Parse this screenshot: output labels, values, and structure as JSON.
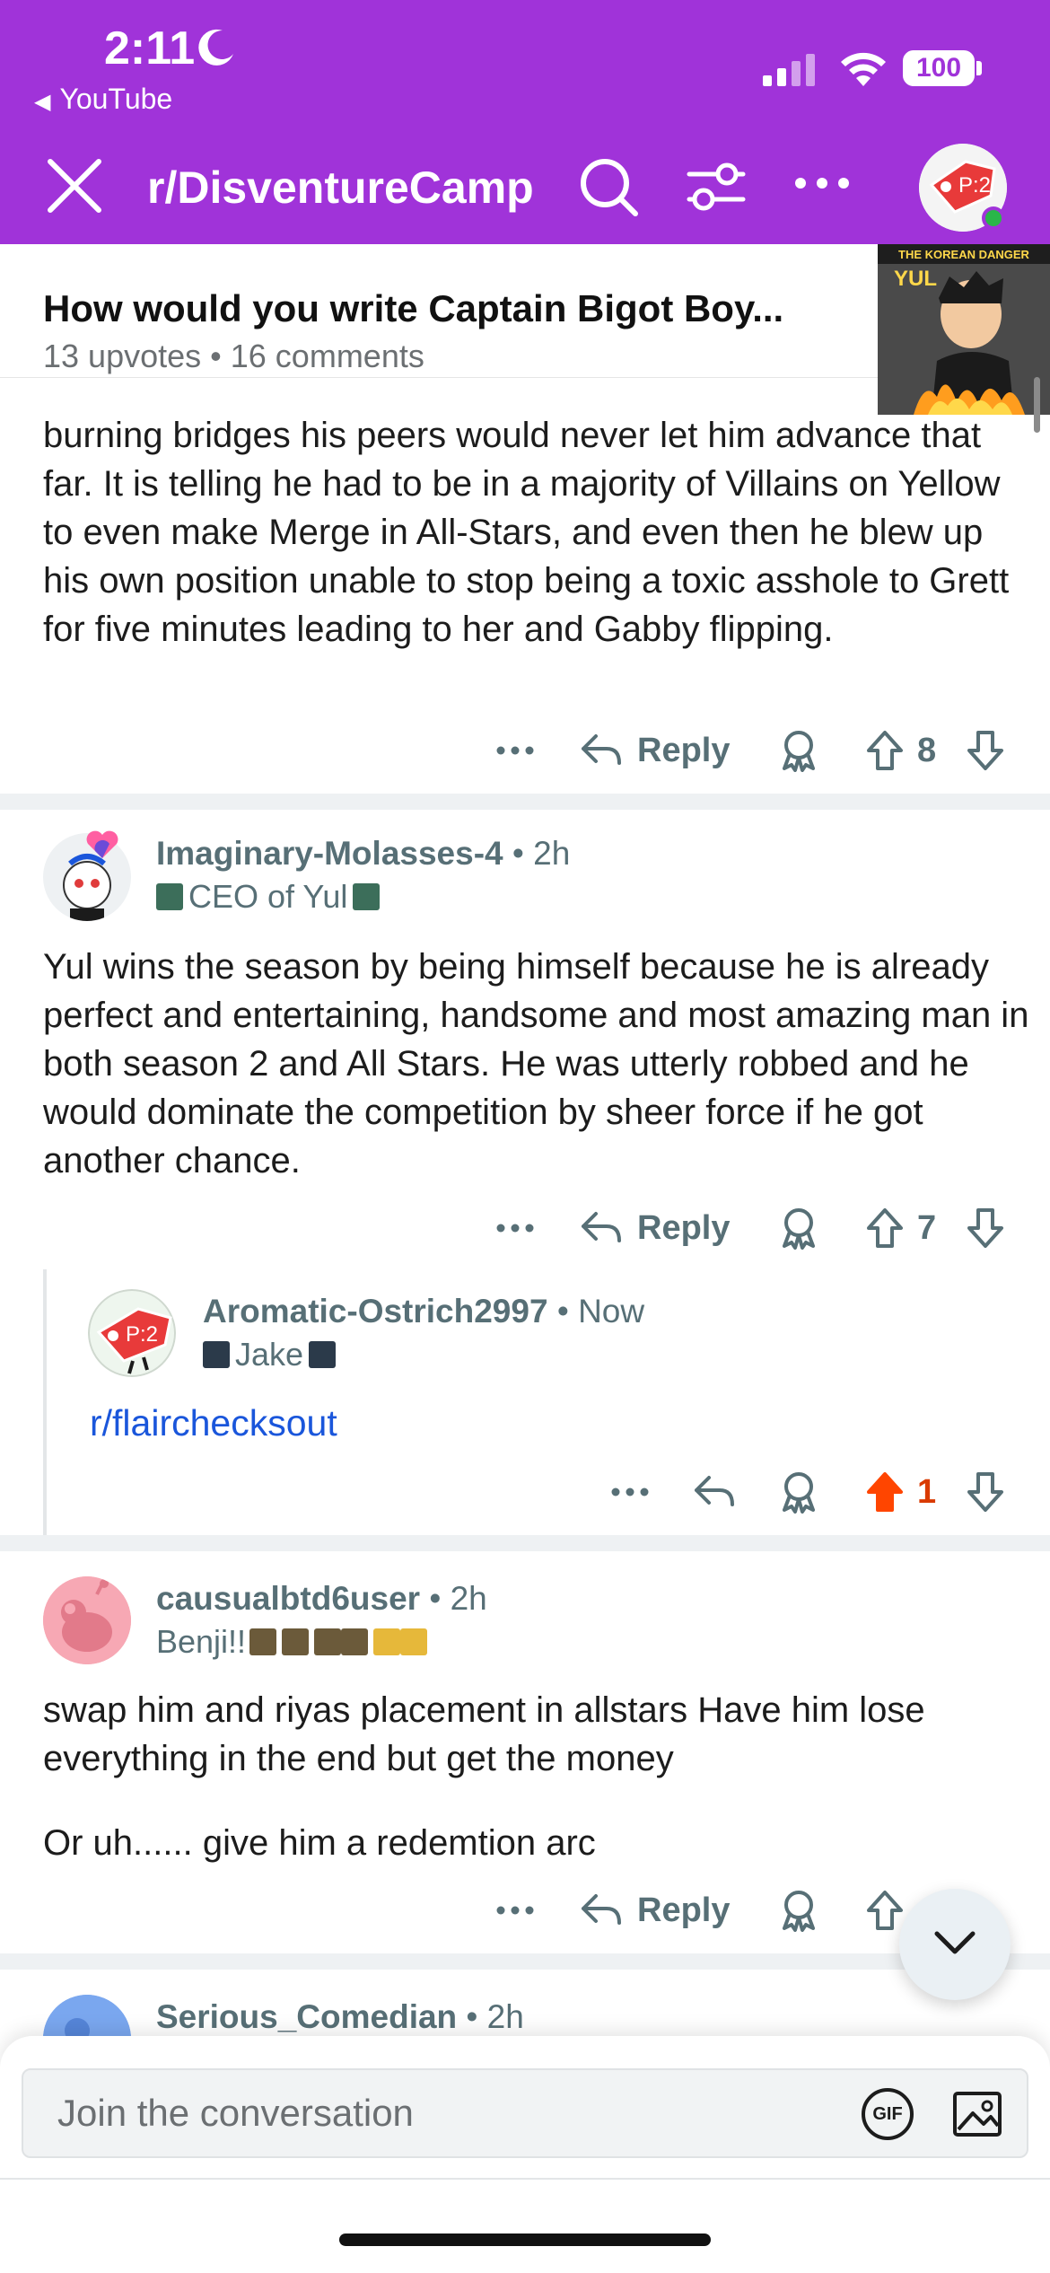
{
  "status_bar": {
    "time": "2:11",
    "back_app": "YouTube",
    "battery": "100"
  },
  "header": {
    "subreddit": "r/DisventureCamp",
    "avatar_badge": "P:2"
  },
  "post": {
    "title": "How would you write Captain Bigot Boy...",
    "upvotes": "13 upvotes",
    "comments": "16 comments",
    "thumbnail_caption": "THE KOREAN DANGER",
    "thumbnail_name": "YUL"
  },
  "comments": [
    {
      "body_tail": "burning bridges his peers would never let him advance that far. It is telling he had to be in a majority of Villains on Yellow to even make Merge in All-Stars, and even then he blew up his own position unable to stop being a toxic asshole to Grett for five minutes leading to her and Gabby flipping.",
      "reply_label": "Reply",
      "votes": "8"
    },
    {
      "user": "Imaginary-Molasses-4",
      "time": "2h",
      "flair": "CEO of Yul",
      "body": "Yul wins the season by being himself because he is already perfect and entertaining, handsome and most amazing man in both season 2 and All Stars. He was utterly robbed and he would dominate the competition by sheer force if he got another chance.",
      "reply_label": "Reply",
      "votes": "7"
    },
    {
      "user": "Aromatic-Ostrich2997",
      "time": "Now",
      "flair": "Jake",
      "body": "r/flairchecksout",
      "avatar_badge": "P:2",
      "votes": "1"
    },
    {
      "user": "causualbtd6user",
      "time": "2h",
      "flair": "Benji!!",
      "body_1": "swap him and riyas placement in allstars Have him lose everything in the end but get the money",
      "body_2": "Or uh...... give him a redemtion arc",
      "reply_label": "Reply"
    },
    {
      "user": "Serious_Comedian",
      "time": "2h"
    }
  ],
  "composer": {
    "placeholder": "Join the conversation",
    "gif_label": "GIF"
  },
  "colors": {
    "brand_purple": "#a033d9",
    "upvote_active": "#ff4500",
    "meta_gray": "#576f76",
    "link_blue": "#1a56db"
  }
}
